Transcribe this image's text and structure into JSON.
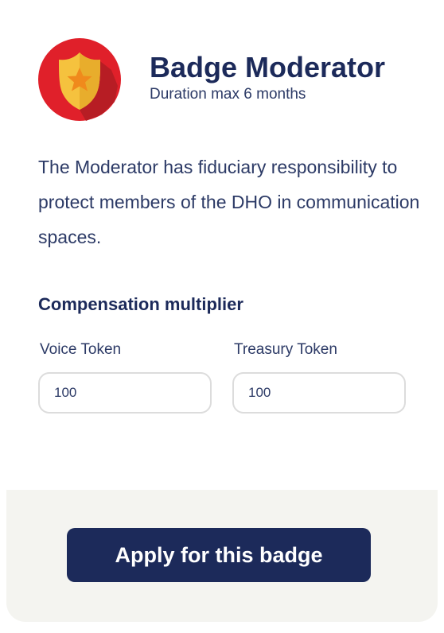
{
  "badge": {
    "title": "Badge Moderator",
    "duration": "Duration max 6 months",
    "icon": "police-badge-icon",
    "description": "The Moderator has fiduciary responsibility to protect members of the DHO in communication spaces."
  },
  "compensation": {
    "section_title": "Compensation multiplier",
    "voice": {
      "label": "Voice Token",
      "value": "100"
    },
    "treasury": {
      "label": "Treasury Token",
      "value": "100"
    }
  },
  "footer": {
    "apply_label": "Apply for this badge"
  },
  "colors": {
    "primary": "#1c2a5a",
    "badge_red": "#e0202a",
    "badge_gold": "#f5c23e",
    "footer_bg": "#f4f4f0"
  }
}
